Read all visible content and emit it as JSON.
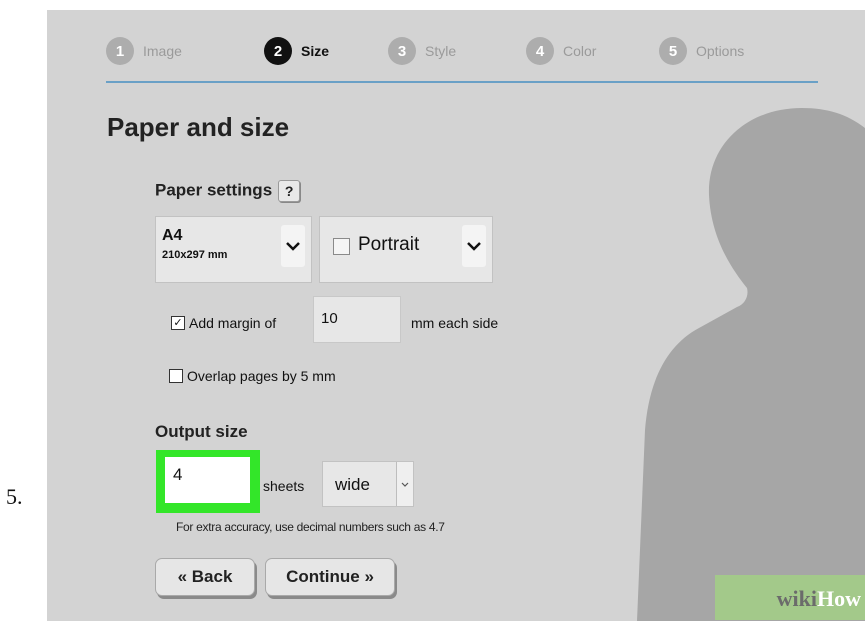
{
  "step_number": "5.",
  "steps": [
    {
      "num": "1",
      "label": "Image"
    },
    {
      "num": "2",
      "label": "Size"
    },
    {
      "num": "3",
      "label": "Style"
    },
    {
      "num": "4",
      "label": "Color"
    },
    {
      "num": "5",
      "label": "Options"
    }
  ],
  "active_step": 2,
  "page_title": "Paper and size",
  "paper_settings": {
    "heading": "Paper settings",
    "help_label": "?",
    "paper_size": "A4",
    "paper_dims": "210x297 mm",
    "orientation": "Portrait"
  },
  "margin": {
    "checked": true,
    "label_before": "Add margin of",
    "value": "10",
    "label_after": "mm each side"
  },
  "overlap": {
    "checked": false,
    "label": "Overlap pages by 5 mm"
  },
  "output_size": {
    "heading": "Output size",
    "value": "4",
    "unit_label": "sheets",
    "direction": "wide",
    "hint": "For extra accuracy, use decimal numbers such as 4.7"
  },
  "buttons": {
    "back": "« Back",
    "continue": "Continue »"
  },
  "watermark": {
    "part1": "wiki",
    "part2": "How"
  },
  "colors": {
    "panel_bg": "#d3d3d3",
    "accent_line": "#6aa0c6",
    "highlight": "#33e629",
    "watermark_bg": "#a3c98a"
  }
}
